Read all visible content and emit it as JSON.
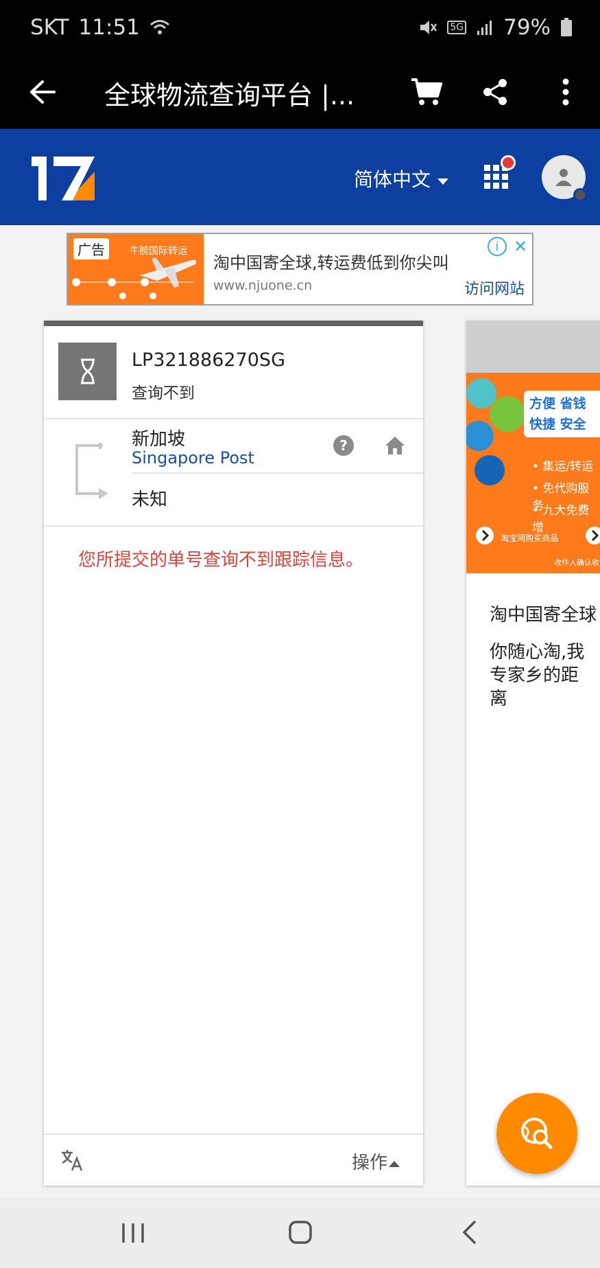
{
  "status_bar": {
    "carrier": "SKT",
    "time": "11:51",
    "network": "5G",
    "battery": "79%"
  },
  "browser": {
    "title": "全球物流查询平台 |..."
  },
  "header": {
    "logo_text": "17",
    "language": "简体中文"
  },
  "ad": {
    "tag": "广告",
    "image_title": "牛腕国际转运",
    "title": "淘中国寄全球,转运费低到你尖叫",
    "url": "www.njuone.cn",
    "visit": "访问网站",
    "info": "i",
    "close": "✕"
  },
  "tracking": {
    "number": "LP321886270SG",
    "status": "查询不到",
    "origin_country": "新加坡",
    "carrier": "Singapore Post",
    "destination": "未知",
    "message": "您所提交的单号查询不到跟踪信息。",
    "actions": "操作"
  },
  "side_ad": {
    "tag_line1": "方便 省钱",
    "tag_line2": "快捷 安全",
    "items": [
      "• 集运/转运",
      "• 免代购服务",
      "• 九大免费增"
    ],
    "bar_text": "淘宝网购买商品",
    "bar_text2": "收件人确认收",
    "text1": "淘中国寄全球",
    "text2": "你随心淘,我专家乡的距离"
  },
  "colors": {
    "header_blue": "#0d3fa0",
    "accent_orange": "#ff8a00",
    "error_red": "#d9453d",
    "carrier_blue": "#1a4fa0"
  }
}
